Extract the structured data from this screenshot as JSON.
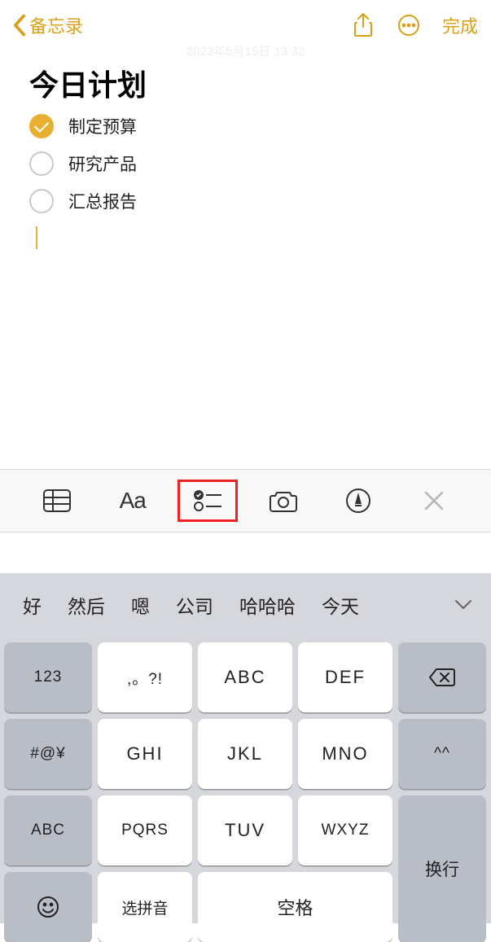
{
  "nav": {
    "back_label": "备忘录",
    "done_label": "完成"
  },
  "watermark": "2023年5月15日 13:32",
  "note": {
    "title": "今日计划",
    "items": [
      {
        "text": "制定预算",
        "checked": true
      },
      {
        "text": "研究产品",
        "checked": false
      },
      {
        "text": "汇总报告",
        "checked": false
      }
    ]
  },
  "toolbar": {
    "format_label": "Aa"
  },
  "candidates": [
    "好",
    "然后",
    "嗯",
    "公司",
    "哈哈哈",
    "今天"
  ],
  "keyboard": {
    "r1": [
      "123",
      ",。?!",
      "ABC",
      "DEF"
    ],
    "r2": [
      "#@¥",
      "GHI",
      "JKL",
      "MNO",
      "^^"
    ],
    "r3": [
      "ABC",
      "PQRS",
      "TUV",
      "WXYZ"
    ],
    "r4_select": "选拼音",
    "r4_space": "空格",
    "r4_return": "换行"
  }
}
